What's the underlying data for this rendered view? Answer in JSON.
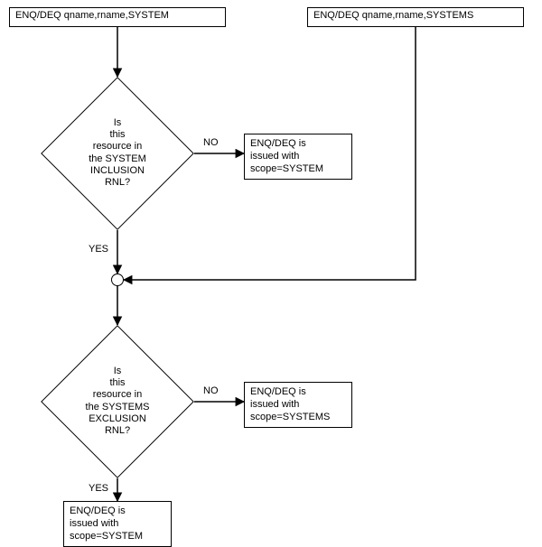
{
  "nodes": {
    "start_system": "ENQ/DEQ qname,rname,SYSTEM",
    "start_systems": "ENQ/DEQ qname,rname,SYSTEMS",
    "decision1": "Is\nthis\nresource in\nthe SYSTEM\nINCLUSION\nRNL?",
    "decision1_no_result": "ENQ/DEQ is\nissued with\nscope=SYSTEM",
    "decision2": "Is\nthis\nresource in\nthe SYSTEMS\nEXCLUSION\nRNL?",
    "decision2_no_result": "ENQ/DEQ is\nissued with\nscope=SYSTEMS",
    "final_result": "ENQ/DEQ is\nissued with\nscope=SYSTEM"
  },
  "labels": {
    "no": "NO",
    "yes": "YES"
  },
  "chart_data": {
    "type": "flowchart",
    "title": "",
    "nodes": [
      {
        "id": "A",
        "type": "process",
        "text": "ENQ/DEQ qname,rname,SYSTEM"
      },
      {
        "id": "B",
        "type": "process",
        "text": "ENQ/DEQ qname,rname,SYSTEMS"
      },
      {
        "id": "D1",
        "type": "decision",
        "text": "Is this resource in the SYSTEM INCLUSION RNL?"
      },
      {
        "id": "R1",
        "type": "process",
        "text": "ENQ/DEQ is issued with scope=SYSTEM"
      },
      {
        "id": "J",
        "type": "connector",
        "text": ""
      },
      {
        "id": "D2",
        "type": "decision",
        "text": "Is this resource in the SYSTEMS EXCLUSION RNL?"
      },
      {
        "id": "R2",
        "type": "process",
        "text": "ENQ/DEQ is issued with scope=SYSTEMS"
      },
      {
        "id": "R3",
        "type": "process",
        "text": "ENQ/DEQ is issued with scope=SYSTEM"
      }
    ],
    "edges": [
      {
        "from": "A",
        "to": "D1",
        "label": ""
      },
      {
        "from": "D1",
        "to": "R1",
        "label": "NO"
      },
      {
        "from": "D1",
        "to": "J",
        "label": "YES"
      },
      {
        "from": "B",
        "to": "J",
        "label": ""
      },
      {
        "from": "J",
        "to": "D2",
        "label": ""
      },
      {
        "from": "D2",
        "to": "R2",
        "label": "NO"
      },
      {
        "from": "D2",
        "to": "R3",
        "label": "YES"
      }
    ]
  }
}
